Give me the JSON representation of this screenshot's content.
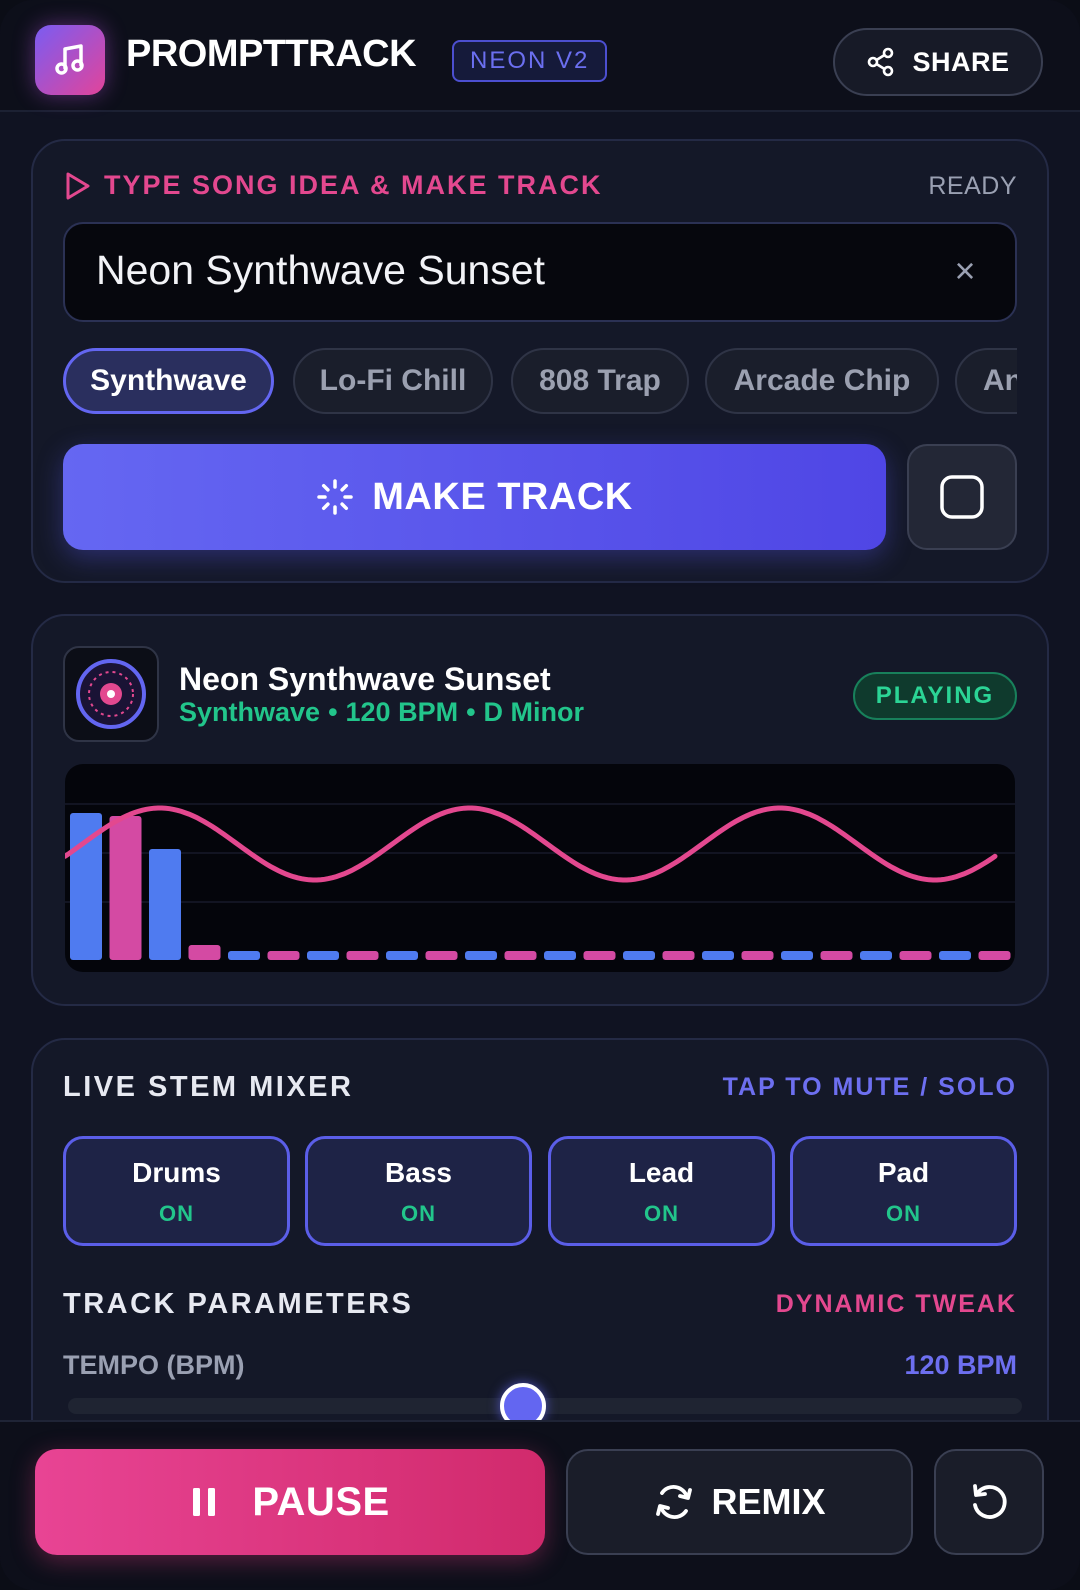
{
  "header": {
    "app_title": "PROMPTTRACK",
    "version_badge": "NEON V2",
    "share_label": "SHARE",
    "logo_icon": "music-note-icon"
  },
  "prompt": {
    "section_label": "TYPE SONG IDEA & MAKE TRACK",
    "status": "READY",
    "input_value": "Neon Synthwave Sunset",
    "clear_symbol": "×",
    "chips": [
      {
        "label": "Synthwave",
        "active": true
      },
      {
        "label": "Lo-Fi Chill",
        "active": false
      },
      {
        "label": "808 Trap",
        "active": false
      },
      {
        "label": "Arcade Chip",
        "active": false
      },
      {
        "label": "An",
        "active": false
      }
    ],
    "make_track_label": "MAKE TRACK"
  },
  "player": {
    "track_title": "Neon Synthwave Sunset",
    "genre": "Synthwave",
    "bpm_text": "120 BPM",
    "key": "D Minor",
    "meta_separator": "•",
    "status_badge": "PLAYING",
    "visualizer": {
      "bar_levels": [
        0.98,
        0.96,
        0.74,
        0.1,
        0.06,
        0.06,
        0.06,
        0.06,
        0.06,
        0.06,
        0.06,
        0.06,
        0.06,
        0.06,
        0.06,
        0.06,
        0.06,
        0.06,
        0.06,
        0.06,
        0.06,
        0.06,
        0.06,
        0.06
      ],
      "wave_cycles": 3
    }
  },
  "mixer": {
    "section_label": "LIVE STEM MIXER",
    "hint": "TAP TO MUTE / SOLO",
    "stems": [
      {
        "name": "Drums",
        "state": "ON"
      },
      {
        "name": "Bass",
        "state": "ON"
      },
      {
        "name": "Lead",
        "state": "ON"
      },
      {
        "name": "Pad",
        "state": "ON"
      }
    ]
  },
  "params": {
    "section_label": "TRACK PARAMETERS",
    "hint": "DYNAMIC TWEAK",
    "tempo_label": "TEMPO (BPM)",
    "tempo_value": "120 BPM"
  },
  "controls": {
    "pause_label": "PAUSE",
    "remix_label": "REMIX"
  },
  "colors": {
    "accent_indigo": "#6366f1",
    "accent_pink": "#e3488f",
    "success_green": "#22c58b"
  }
}
